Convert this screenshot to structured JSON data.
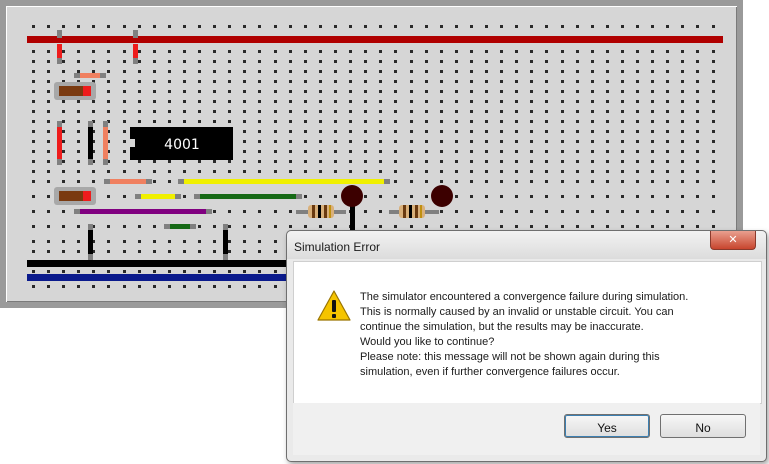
{
  "board": {
    "chip_label": "4001",
    "colors": {
      "board": "#d6d6d6",
      "frame": "#9a9a9a",
      "hole": "#2a2a2a",
      "power_rail_red": "#b00000",
      "power_rail_black": "#000000",
      "power_rail_blue": "#0a1a8c",
      "wire_red": "#ee1c1c",
      "wire_yellow": "#f0f000",
      "wire_green": "#166a16",
      "wire_purple": "#800080",
      "wire_salmon": "#f08060",
      "chip": "#000000",
      "led": "#3c0000"
    }
  },
  "dialog": {
    "title": "Simulation Error",
    "close_glyph": "✕",
    "icon": "warning-icon",
    "message_lines": [
      "The simulator encountered a convergence failure during simulation.",
      "This is normally caused by an invalid or unstable circuit. You can",
      "continue the simulation, but the results may be inaccurate.",
      "Would you like to continue?",
      "Please note: this message will not be shown again during this",
      "simulation, even if further convergence failures occur."
    ],
    "buttons": {
      "yes": "Yes",
      "no": "No"
    }
  }
}
